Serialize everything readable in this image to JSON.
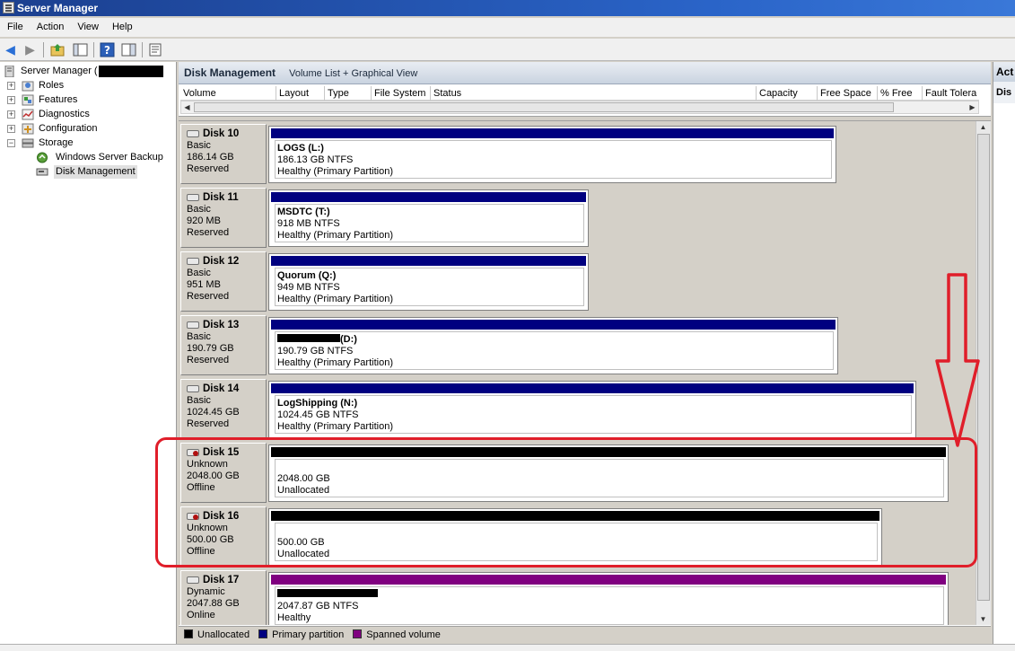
{
  "window": {
    "title": "Server Manager"
  },
  "menu": [
    "File",
    "Action",
    "View",
    "Help"
  ],
  "toolbar": {
    "icons": [
      "back-arrow-icon",
      "forward-arrow-icon",
      "up-folder-icon",
      "show-hide-tree-icon",
      "help-icon",
      "properties-icon",
      "export-icon"
    ]
  },
  "tree": {
    "root": "Server Manager (",
    "roles": "Roles",
    "features": "Features",
    "diagnostics": "Diagnostics",
    "configuration": "Configuration",
    "storage": "Storage",
    "backup": "Windows Server Backup",
    "disk_management": "Disk Management"
  },
  "main": {
    "title": "Disk Management",
    "subtitle": "Volume List + Graphical View",
    "columns": [
      "Volume",
      "Layout",
      "Type",
      "File System",
      "Status",
      "Capacity",
      "Free Space",
      "% Free",
      "Fault Tolera"
    ]
  },
  "disks": [
    {
      "name": "Disk 10",
      "type": "Basic",
      "size": "186.14 GB",
      "state": "Reserved",
      "volume_name": "LOGS  (L:)",
      "volume_size": "186.13 GB NTFS",
      "volume_status": "Healthy (Primary Partition)",
      "bar_color": "#000080",
      "redacted": false
    },
    {
      "name": "Disk 11",
      "type": "Basic",
      "size": "920 MB",
      "state": "Reserved",
      "volume_name": "MSDTC  (T:)",
      "volume_size": "918 MB NTFS",
      "volume_status": "Healthy (Primary Partition)",
      "bar_color": "#000080",
      "redacted": false
    },
    {
      "name": "Disk 12",
      "type": "Basic",
      "size": "951 MB",
      "state": "Reserved",
      "volume_name": "Quorum  (Q:)",
      "volume_size": "949 MB NTFS",
      "volume_status": "Healthy (Primary Partition)",
      "bar_color": "#000080",
      "redacted": false
    },
    {
      "name": "Disk 13",
      "type": "Basic",
      "size": "190.79 GB",
      "state": "Reserved",
      "volume_name": "(D:)",
      "volume_size": "190.79 GB NTFS",
      "volume_status": "Healthy (Primary Partition)",
      "bar_color": "#000080",
      "redacted": true
    },
    {
      "name": "Disk 14",
      "type": "Basic",
      "size": "1024.45 GB",
      "state": "Reserved",
      "volume_name": "LogShipping  (N:)",
      "volume_size": "1024.45 GB NTFS",
      "volume_status": "Healthy (Primary Partition)",
      "bar_color": "#000080",
      "redacted": false
    },
    {
      "name": "Disk 15",
      "type": "Unknown",
      "size": "2048.00 GB",
      "state": "Offline",
      "volume_name": "",
      "volume_size": "2048.00 GB",
      "volume_status": "Unallocated",
      "bar_color": "#000000",
      "redacted": false
    },
    {
      "name": "Disk 16",
      "type": "Unknown",
      "size": "500.00 GB",
      "state": "Offline",
      "volume_name": "",
      "volume_size": "500.00 GB",
      "volume_status": "Unallocated",
      "bar_color": "#000000",
      "redacted": false
    },
    {
      "name": "Disk 17",
      "type": "Dynamic",
      "size": "2047.88 GB",
      "state": "Online",
      "volume_name": "",
      "volume_size": "2047.87 GB NTFS",
      "volume_status": "Healthy",
      "bar_color": "#800080",
      "redacted": true
    }
  ],
  "legend": [
    {
      "label": "Unallocated",
      "color": "#000000"
    },
    {
      "label": "Primary partition",
      "color": "#000080"
    },
    {
      "label": "Spanned volume",
      "color": "#800080"
    }
  ],
  "actions": {
    "header": "Act",
    "section": "Dis"
  },
  "colors": {
    "annotation_red": "#e01e2a",
    "primary": "#000080",
    "spanned": "#800080",
    "unallocated": "#000000"
  }
}
